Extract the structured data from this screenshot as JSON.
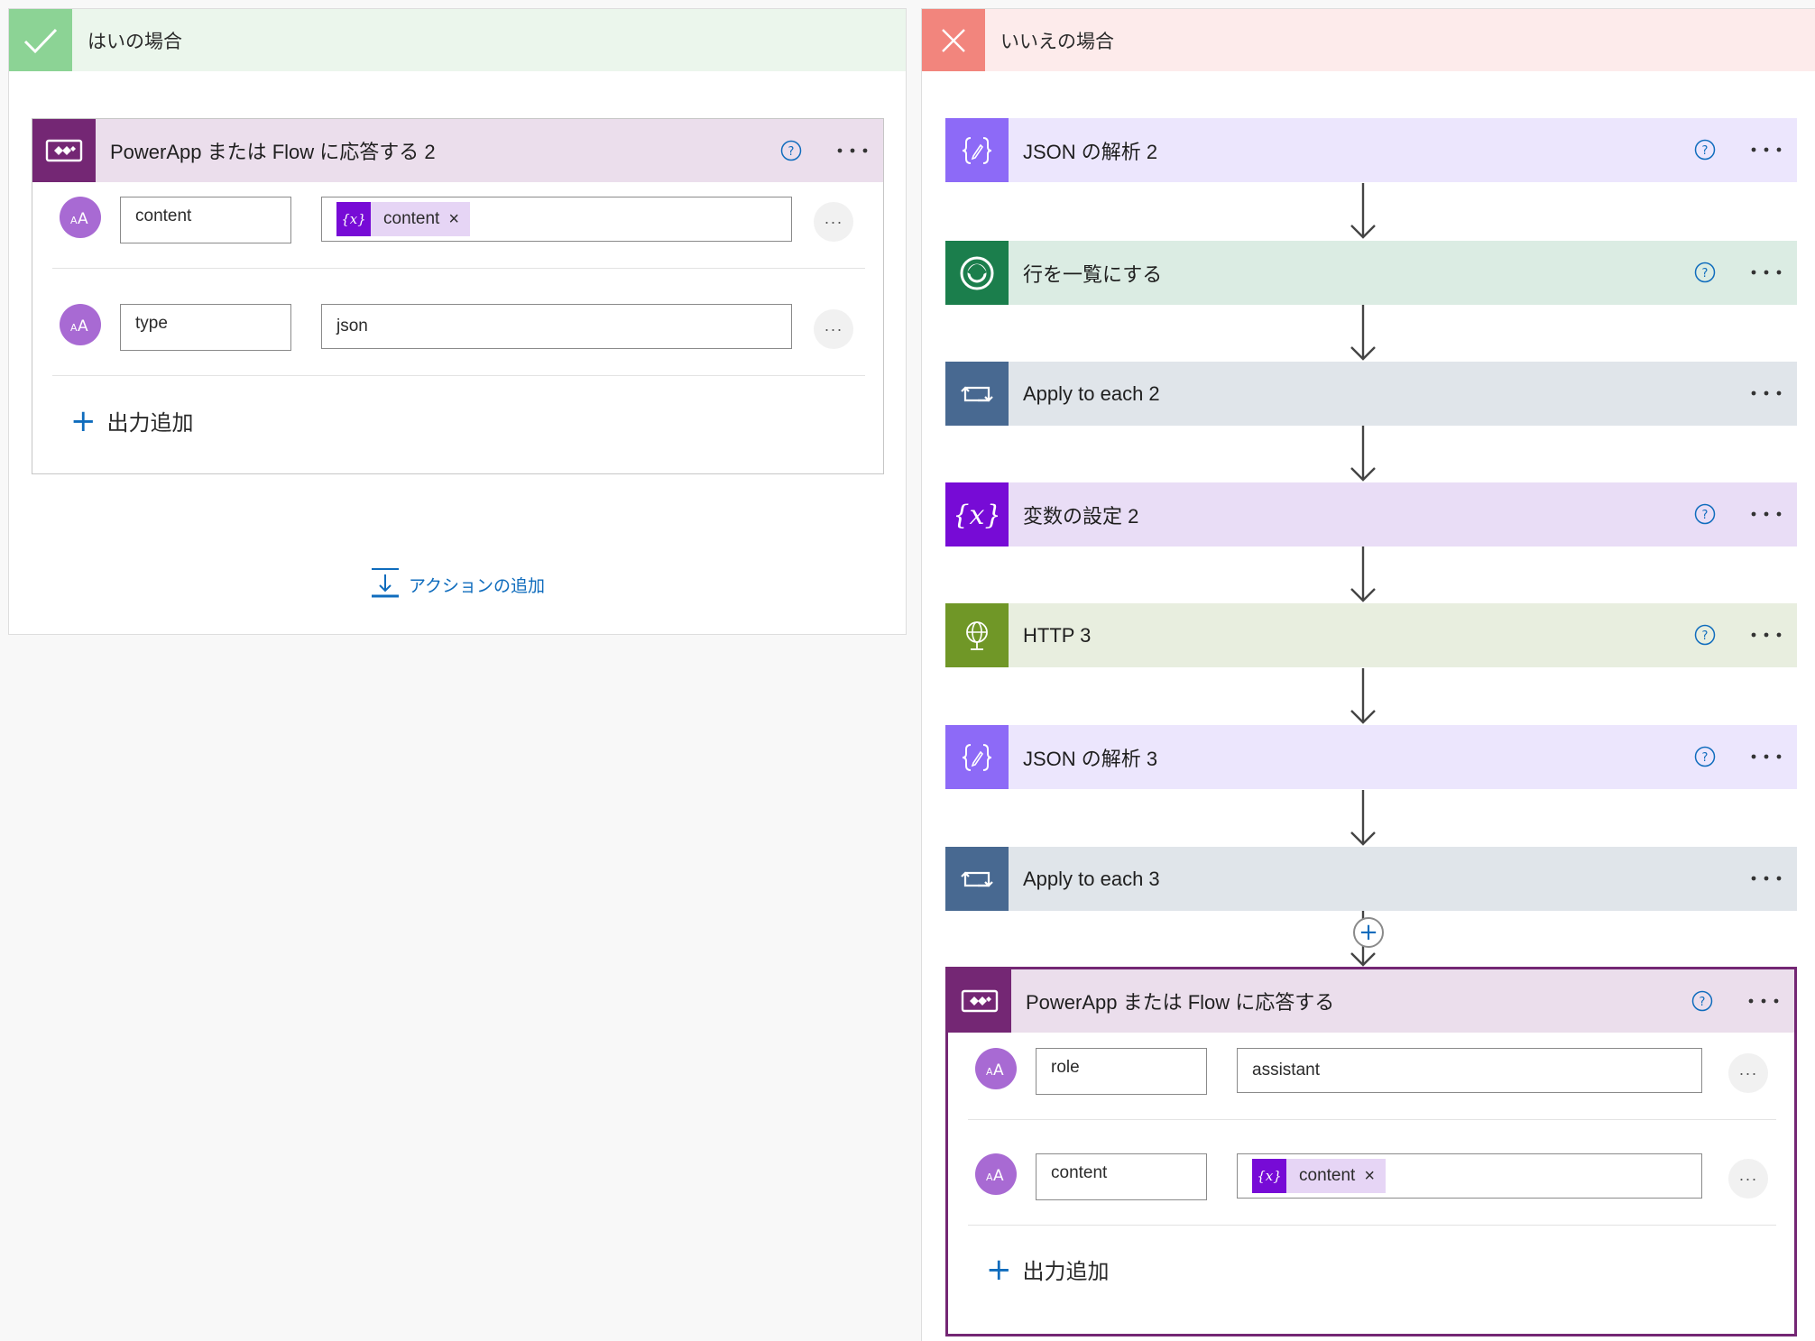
{
  "yes_branch": {
    "title": "はいの場合",
    "check_icon": "check-icon",
    "response_card": {
      "title": "PowerApp または Flow に応答する 2",
      "icon": "powerapps-icon",
      "header_color": "#ebdeec",
      "icon_color": "#742774",
      "outputs": [
        {
          "key": "content",
          "value_token": {
            "icon": "variable-icon",
            "icon_text": "{x}",
            "label": "content",
            "remove": "×"
          }
        },
        {
          "key": "type",
          "value": "json"
        }
      ],
      "row_more": "···",
      "add_output_label": "出力追加",
      "add_output_plus": "+"
    },
    "add_action_label": "アクションの追加"
  },
  "no_branch": {
    "title": "いいえの場合",
    "close_icon": "close-icon",
    "steps": [
      {
        "title": "JSON の解析 2",
        "icon": "parse-json-icon",
        "header_color": "#ece6fd",
        "icon_color": "#8d6af7",
        "help": true
      },
      {
        "title": "行を一覧にする",
        "icon": "dataverse-icon",
        "header_color": "#dbece3",
        "icon_color": "#1b7e4c",
        "help": true
      },
      {
        "title": "Apply to each 2",
        "icon": "loop-icon",
        "header_color": "#e0e5ea",
        "icon_color": "#486991",
        "help": false
      },
      {
        "title": "変数の設定 2",
        "icon": "variable-icon",
        "header_color": "#e9ddf6",
        "icon_color": "#770bd6",
        "help": true
      },
      {
        "title": "HTTP 3",
        "icon": "http-globe-icon",
        "header_color": "#e8eedf",
        "icon_color": "#709727",
        "help": true
      },
      {
        "title": "JSON の解析 3",
        "icon": "parse-json-icon",
        "header_color": "#ece6fd",
        "icon_color": "#8d6af7",
        "help": true
      },
      {
        "title": "Apply to each 3",
        "icon": "loop-icon",
        "header_color": "#e0e5ea",
        "icon_color": "#486991",
        "help": false
      }
    ],
    "insert_plus": "+",
    "response_card": {
      "title": "PowerApp または Flow に応答する",
      "icon": "powerapps-icon",
      "header_color": "#ebdeec",
      "icon_color": "#742774",
      "outputs": [
        {
          "key": "role",
          "value": "assistant"
        },
        {
          "key": "content",
          "value_token": {
            "icon": "variable-icon",
            "icon_text": "{x}",
            "label": "content",
            "remove": "×"
          }
        }
      ],
      "row_more": "···",
      "add_output_label": "出力追加",
      "add_output_plus": "+"
    }
  },
  "common": {
    "more_label": "···",
    "help_icon": "help-icon",
    "accent": "#0f6cbd"
  }
}
